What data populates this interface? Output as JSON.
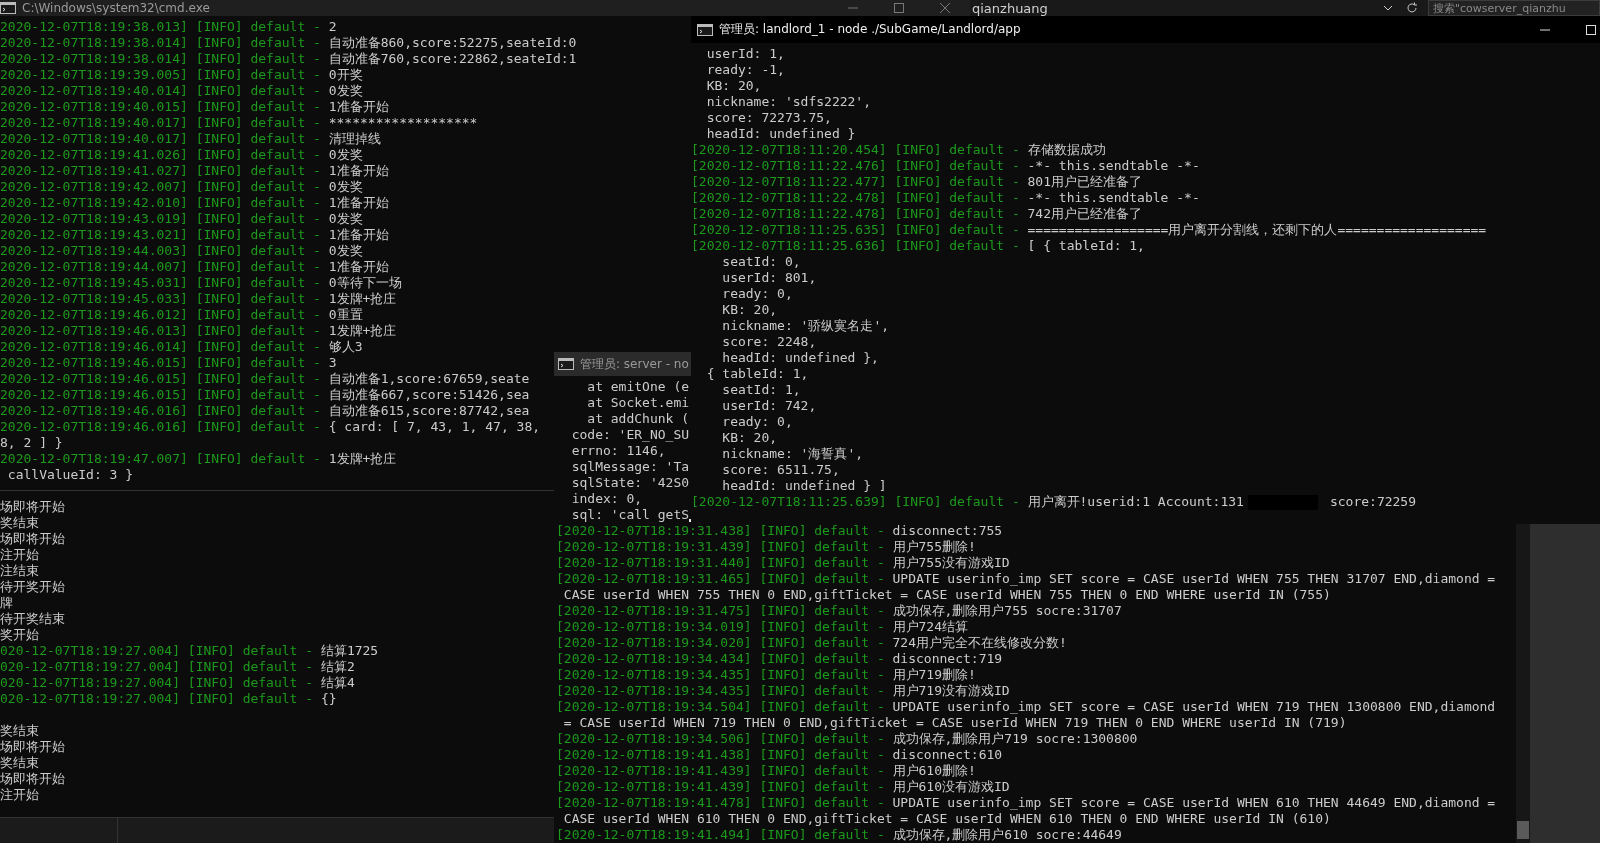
{
  "cmd_window": {
    "title": "C:\\Windows\\system32\\cmd.exe",
    "lines": [
      {
        "kind": "log",
        "prefix": "2020-12-07T18:19:38.013] [INFO] default -",
        "message": "2"
      },
      {
        "kind": "log",
        "prefix": "2020-12-07T18:19:38.014] [INFO] default -",
        "message": "自动准备860,score:52275,seateId:0"
      },
      {
        "kind": "log",
        "prefix": "2020-12-07T18:19:38.014] [INFO] default -",
        "message": "自动准备760,score:22862,seateId:1"
      },
      {
        "kind": "log",
        "prefix": "2020-12-07T18:19:39.005] [INFO] default -",
        "message": "0开奖"
      },
      {
        "kind": "log",
        "prefix": "2020-12-07T18:19:40.014] [INFO] default -",
        "message": "0发奖"
      },
      {
        "kind": "log",
        "prefix": "2020-12-07T18:19:40.015] [INFO] default -",
        "message": "1准备开始"
      },
      {
        "kind": "log",
        "prefix": "2020-12-07T18:19:40.017] [INFO] default -",
        "message": "*******************"
      },
      {
        "kind": "log",
        "prefix": "2020-12-07T18:19:40.017] [INFO] default -",
        "message": "清理掉线"
      },
      {
        "kind": "log",
        "prefix": "2020-12-07T18:19:41.026] [INFO] default -",
        "message": "0发奖"
      },
      {
        "kind": "log",
        "prefix": "2020-12-07T18:19:41.027] [INFO] default -",
        "message": "1准备开始"
      },
      {
        "kind": "log",
        "prefix": "2020-12-07T18:19:42.007] [INFO] default -",
        "message": "0发奖"
      },
      {
        "kind": "log",
        "prefix": "2020-12-07T18:19:42.010] [INFO] default -",
        "message": "1准备开始"
      },
      {
        "kind": "log",
        "prefix": "2020-12-07T18:19:43.019] [INFO] default -",
        "message": "0发奖"
      },
      {
        "kind": "log",
        "prefix": "2020-12-07T18:19:43.021] [INFO] default -",
        "message": "1准备开始"
      },
      {
        "kind": "log",
        "prefix": "2020-12-07T18:19:44.003] [INFO] default -",
        "message": "0发奖"
      },
      {
        "kind": "log",
        "prefix": "2020-12-07T18:19:44.007] [INFO] default -",
        "message": "1准备开始"
      },
      {
        "kind": "log",
        "prefix": "2020-12-07T18:19:45.031] [INFO] default -",
        "message": "0等待下一场"
      },
      {
        "kind": "log",
        "prefix": "2020-12-07T18:19:45.033] [INFO] default -",
        "message": "1发牌+抢庄"
      },
      {
        "kind": "log",
        "prefix": "2020-12-07T18:19:46.012] [INFO] default -",
        "message": "0重置"
      },
      {
        "kind": "log",
        "prefix": "2020-12-07T18:19:46.013] [INFO] default -",
        "message": "1发牌+抢庄"
      },
      {
        "kind": "log",
        "prefix": "2020-12-07T18:19:46.014] [INFO] default -",
        "message": "够人3"
      },
      {
        "kind": "log",
        "prefix": "2020-12-07T18:19:46.015] [INFO] default -",
        "message": "3"
      },
      {
        "kind": "log",
        "prefix": "2020-12-07T18:19:46.015] [INFO] default -",
        "message": "自动准备1,score:67659,seate"
      },
      {
        "kind": "log",
        "prefix": "2020-12-07T18:19:46.015] [INFO] default -",
        "message": "自动准备667,score:51426,sea"
      },
      {
        "kind": "log",
        "prefix": "2020-12-07T18:19:46.016] [INFO] default -",
        "message": "自动准备615,score:87742,sea"
      },
      {
        "kind": "log",
        "prefix": "2020-12-07T18:19:46.016] [INFO] default -",
        "message": "{ card: [ 7, 43, 1, 47, 38,"
      },
      {
        "kind": "text",
        "text": "8, 2 ] }"
      },
      {
        "kind": "log",
        "prefix": "2020-12-07T18:19:47.007] [INFO] default -",
        "message": "1发牌+抢庄"
      },
      {
        "kind": "text",
        "text": " callValueId: 3 }"
      }
    ],
    "lower_lines": [
      {
        "kind": "text",
        "text": "场即将开始"
      },
      {
        "kind": "text",
        "text": "奖结束"
      },
      {
        "kind": "text",
        "text": "场即将开始"
      },
      {
        "kind": "text",
        "text": "注开始"
      },
      {
        "kind": "text",
        "text": "注结束"
      },
      {
        "kind": "text",
        "text": "待开奖开始"
      },
      {
        "kind": "text",
        "text": "牌"
      },
      {
        "kind": "text",
        "text": "待开奖结束"
      },
      {
        "kind": "text",
        "text": "奖开始"
      },
      {
        "kind": "log",
        "prefix": "020-12-07T18:19:27.004] [INFO] default -",
        "message": "结算1725"
      },
      {
        "kind": "log",
        "prefix": "020-12-07T18:19:27.004] [INFO] default -",
        "message": "结算2"
      },
      {
        "kind": "log",
        "prefix": "020-12-07T18:19:27.004] [INFO] default -",
        "message": "结算4"
      },
      {
        "kind": "log",
        "prefix": "020-12-07T18:19:27.004] [INFO] default -",
        "message": "{}"
      },
      {
        "kind": "blank"
      },
      {
        "kind": "text",
        "text": "奖结束"
      },
      {
        "kind": "text",
        "text": "场即将开始"
      },
      {
        "kind": "text",
        "text": "奖结束"
      },
      {
        "kind": "text",
        "text": "场即将开始"
      },
      {
        "kind": "text",
        "text": "注开始"
      }
    ]
  },
  "explorer_window": {
    "address": "qianzhuang",
    "search": {
      "placeholder": "搜索\"cowserver_qianzhu"
    }
  },
  "server_window": {
    "title": "管理员: server - no",
    "lines": [
      {
        "kind": "text",
        "text": "    at emitOne (e"
      },
      {
        "kind": "text",
        "text": "    at Socket.emi"
      },
      {
        "kind": "text",
        "text": "    at addChunk ("
      },
      {
        "kind": "text",
        "text": "  code: 'ER_NO_SU"
      },
      {
        "kind": "text",
        "text": "  errno: 1146,"
      },
      {
        "kind": "text",
        "text": "  sqlMessage: 'Ta"
      },
      {
        "kind": "text",
        "text": "  sqlState: '42S0"
      },
      {
        "kind": "text",
        "text": "  index: 0,"
      },
      {
        "kind": "text",
        "text": "  sql: 'call getS",
        "cursor": true
      },
      {
        "kind": "log",
        "prefix": "[2020-12-07T18:19:31.438] [INFO] default -",
        "message": "disconnect:755"
      },
      {
        "kind": "log",
        "prefix": "[2020-12-07T18:19:31.439] [INFO] default -",
        "message": "用户755删除!"
      },
      {
        "kind": "log",
        "prefix": "[2020-12-07T18:19:31.440] [INFO] default -",
        "message": "用户755没有游戏ID"
      },
      {
        "kind": "log",
        "prefix": "[2020-12-07T18:19:31.465] [INFO] default -",
        "message": "UPDATE userinfo_imp SET score = CASE userId WHEN 755 THEN 31707 END,diamond ="
      },
      {
        "kind": "text",
        "text": " CASE userId WHEN 755 THEN 0 END,giftTicket = CASE userId WHEN 755 THEN 0 END WHERE userId IN (755)"
      },
      {
        "kind": "log",
        "prefix": "[2020-12-07T18:19:31.475] [INFO] default -",
        "message": "成功保存,删除用户755 socre:31707"
      },
      {
        "kind": "log",
        "prefix": "[2020-12-07T18:19:34.019] [INFO] default -",
        "message": "用户724结算"
      },
      {
        "kind": "log",
        "prefix": "[2020-12-07T18:19:34.020] [INFO] default -",
        "message": "724用户完全不在线修改分数!"
      },
      {
        "kind": "log",
        "prefix": "[2020-12-07T18:19:34.434] [INFO] default -",
        "message": "disconnect:719"
      },
      {
        "kind": "log",
        "prefix": "[2020-12-07T18:19:34.435] [INFO] default -",
        "message": "用户719删除!"
      },
      {
        "kind": "log",
        "prefix": "[2020-12-07T18:19:34.435] [INFO] default -",
        "message": "用户719没有游戏ID"
      },
      {
        "kind": "log",
        "prefix": "[2020-12-07T18:19:34.504] [INFO] default -",
        "message": "UPDATE userinfo_imp SET score = CASE userId WHEN 719 THEN 1300800 END,diamond"
      },
      {
        "kind": "text",
        "text": " = CASE userId WHEN 719 THEN 0 END,giftTicket = CASE userId WHEN 719 THEN 0 END WHERE userId IN (719)"
      },
      {
        "kind": "log",
        "prefix": "[2020-12-07T18:19:34.506] [INFO] default -",
        "message": "成功保存,删除用户719 socre:1300800"
      },
      {
        "kind": "log",
        "prefix": "[2020-12-07T18:19:41.438] [INFO] default -",
        "message": "disconnect:610"
      },
      {
        "kind": "log",
        "prefix": "[2020-12-07T18:19:41.439] [INFO] default -",
        "message": "用户610删除!"
      },
      {
        "kind": "log",
        "prefix": "[2020-12-07T18:19:41.439] [INFO] default -",
        "message": "用户610没有游戏ID"
      },
      {
        "kind": "log",
        "prefix": "[2020-12-07T18:19:41.478] [INFO] default -",
        "message": "UPDATE userinfo_imp SET score = CASE userId WHEN 610 THEN 44649 END,diamond ="
      },
      {
        "kind": "text",
        "text": " CASE userId WHEN 610 THEN 0 END,giftTicket = CASE userId WHEN 610 THEN 0 END WHERE userId IN (610)"
      },
      {
        "kind": "log",
        "prefix": "[2020-12-07T18:19:41.494] [INFO] default -",
        "message": "成功保存,删除用户610 socre:44649"
      }
    ]
  },
  "landlord_window": {
    "title": "管理员: landlord_1 - node ./SubGame/Landlord/app",
    "lines": [
      {
        "kind": "text",
        "text": "  userId: 1,"
      },
      {
        "kind": "text",
        "text": "  ready: -1,"
      },
      {
        "kind": "text",
        "text": "  KB: 20,"
      },
      {
        "kind": "text",
        "text": "  nickname: 'sdfs2222',"
      },
      {
        "kind": "text",
        "text": "  score: 72273.75,"
      },
      {
        "kind": "text",
        "text": "  headId: undefined }"
      },
      {
        "kind": "log",
        "prefix": "[2020-12-07T18:11:20.454] [INFO] default -",
        "message": "存储数据成功"
      },
      {
        "kind": "log",
        "prefix": "[2020-12-07T18:11:22.476] [INFO] default -",
        "message": "-*- this.sendtable -*-"
      },
      {
        "kind": "log",
        "prefix": "[2020-12-07T18:11:22.477] [INFO] default -",
        "message": "801用户已经准备了"
      },
      {
        "kind": "log",
        "prefix": "[2020-12-07T18:11:22.478] [INFO] default -",
        "message": "-*- this.sendtable -*-"
      },
      {
        "kind": "log",
        "prefix": "[2020-12-07T18:11:22.478] [INFO] default -",
        "message": "742用户已经准备了"
      },
      {
        "kind": "log",
        "prefix": "[2020-12-07T18:11:25.635] [INFO] default -",
        "message": "==================用户离开分割线，还剩下的人==================="
      },
      {
        "kind": "log",
        "prefix": "[2020-12-07T18:11:25.636] [INFO] default -",
        "message": "[ { tableId: 1,"
      },
      {
        "kind": "text",
        "text": "    seatId: 0,"
      },
      {
        "kind": "text",
        "text": "    userId: 801,"
      },
      {
        "kind": "text",
        "text": "    ready: 0,"
      },
      {
        "kind": "text",
        "text": "    KB: 20,"
      },
      {
        "kind": "text",
        "text": "    nickname: '骄纵寞名走',"
      },
      {
        "kind": "text",
        "text": "    score: 2248,"
      },
      {
        "kind": "text",
        "text": "    headId: undefined },"
      },
      {
        "kind": "text",
        "text": "  { tableId: 1,"
      },
      {
        "kind": "text",
        "text": "    seatId: 1,"
      },
      {
        "kind": "text",
        "text": "    userId: 742,"
      },
      {
        "kind": "text",
        "text": "    ready: 0,"
      },
      {
        "kind": "text",
        "text": "    KB: 20,"
      },
      {
        "kind": "text",
        "text": "    nickname: '海誓真',"
      },
      {
        "kind": "text",
        "text": "    score: 6511.75,"
      },
      {
        "kind": "text",
        "text": "    headId: undefined } ]"
      },
      {
        "kind": "log",
        "prefix": "[2020-12-07T18:11:25.639] [INFO] default -",
        "message": "用户离开!userid:1 Account:131",
        "redacted": true,
        "message_after": "score:72259"
      }
    ]
  }
}
